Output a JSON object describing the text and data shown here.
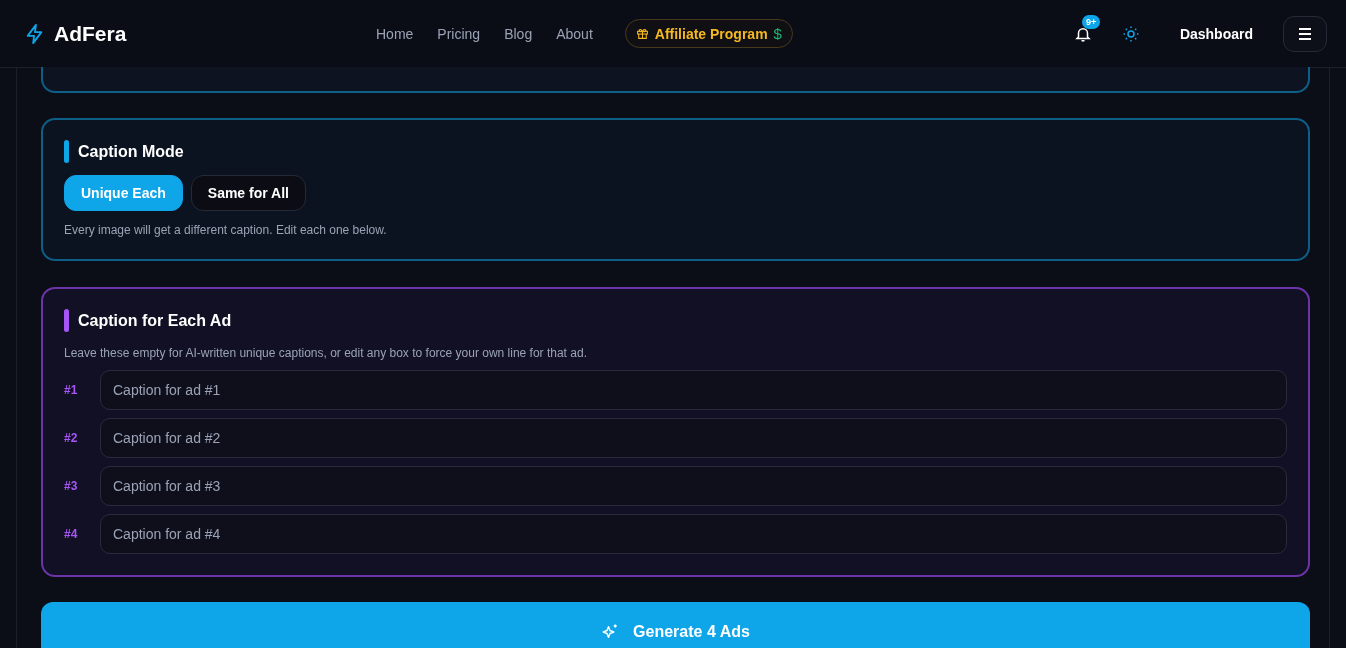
{
  "brand": "AdFera",
  "nav": [
    {
      "label": "Home"
    },
    {
      "label": "Pricing"
    },
    {
      "label": "Blog"
    },
    {
      "label": "About"
    }
  ],
  "affiliate": {
    "label": "Affiliate Program",
    "currency": "$"
  },
  "notifications": {
    "badge": "9+"
  },
  "dashboard": "Dashboard",
  "caption_mode": {
    "title": "Caption Mode",
    "options": [
      {
        "label": "Unique Each",
        "selected": true
      },
      {
        "label": "Same for All",
        "selected": false
      }
    ],
    "hint": "Every image will get a different caption. Edit each one below."
  },
  "captions": {
    "title": "Caption for Each Ad",
    "hint": "Leave these empty for AI-written unique captions, or edit any box to force your own line for that ad.",
    "items": [
      {
        "number": "#1",
        "placeholder": "Caption for ad #1"
      },
      {
        "number": "#2",
        "placeholder": "Caption for ad #2"
      },
      {
        "number": "#3",
        "placeholder": "Caption for ad #3"
      },
      {
        "number": "#4",
        "placeholder": "Caption for ad #4"
      }
    ]
  },
  "generate": "Generate 4 Ads"
}
